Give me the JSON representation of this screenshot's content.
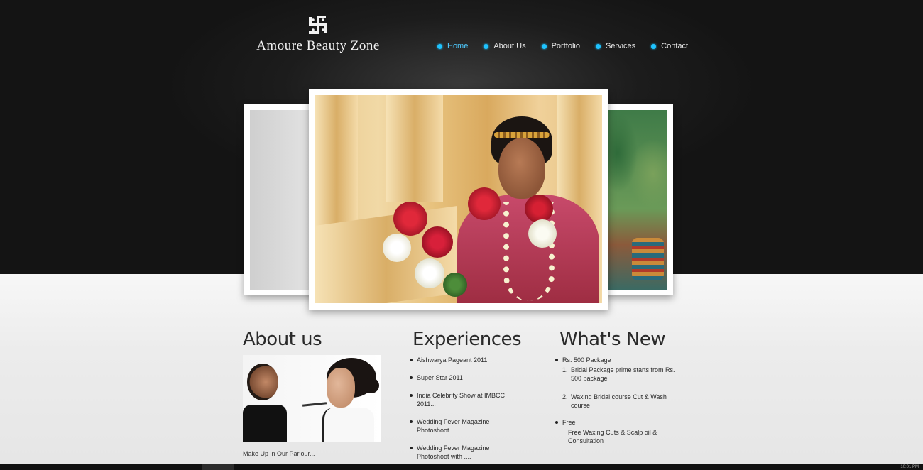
{
  "brand": {
    "name": "Amoure Beauty Zone",
    "logo_icon": "swastika-mark-icon"
  },
  "nav": {
    "items": [
      {
        "label": "Home",
        "active": true
      },
      {
        "label": "About Us",
        "active": false
      },
      {
        "label": "Portfolio",
        "active": false
      },
      {
        "label": "Services",
        "active": false
      },
      {
        "label": "Contact",
        "active": false
      }
    ]
  },
  "colors": {
    "accent": "#1ec3ff",
    "header_bg": "#1c1c1c",
    "content_bg": "#ececec"
  },
  "slider": {
    "images": [
      "bride-portrait",
      "makeup-room",
      "henna-hands"
    ]
  },
  "about": {
    "title": "About us",
    "caption": "Make Up in Our Parlour..."
  },
  "experiences": {
    "title": "Experiences",
    "items": [
      "Aishwarya Pageant 2011",
      "Super Star 2011",
      "India Celebrity Show at IMBCC 2011...",
      "Wedding Fever Magazine Photoshoot",
      "Wedding Fever Magazine Photoshoot with ...."
    ]
  },
  "whats_new": {
    "title": "What's New",
    "groups": [
      {
        "head": "Rs. 500 Package",
        "subs": [
          {
            "num": "1.",
            "text": "Bridal Package prime starts from Rs. 500 package"
          },
          {
            "num": "2.",
            "text": "Waxing Bridal course Cut & Wash course"
          }
        ]
      },
      {
        "head": "Free",
        "text": "Free Waxing Cuts & Scalp oil & Consultation"
      }
    ]
  },
  "footer": {
    "clock": "10:01 PM"
  }
}
